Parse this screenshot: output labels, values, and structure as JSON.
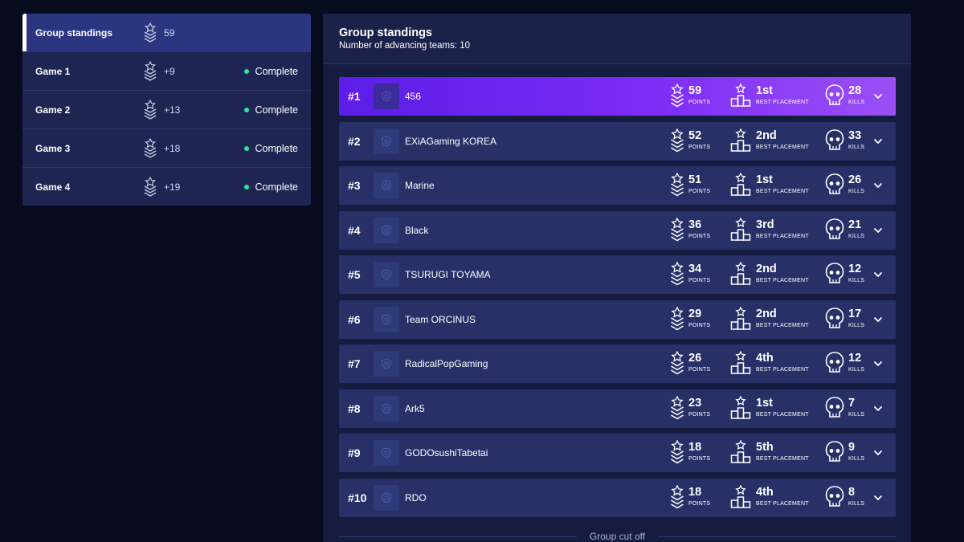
{
  "sidebar": {
    "items": [
      {
        "label": "Group standings",
        "points": "59",
        "status": ""
      },
      {
        "label": "Game 1",
        "points": "+9",
        "status": "Complete"
      },
      {
        "label": "Game 2",
        "points": "+13",
        "status": "Complete"
      },
      {
        "label": "Game 3",
        "points": "+18",
        "status": "Complete"
      },
      {
        "label": "Game 4",
        "points": "+19",
        "status": "Complete"
      }
    ]
  },
  "panel": {
    "title": "Group standings",
    "subtitle": "Number of advancing teams: 10"
  },
  "labels": {
    "points": "POINTS",
    "best_placement": "BEST PLACEMENT",
    "kills": "KILLS"
  },
  "teams": [
    {
      "rank": "#1",
      "name": "456",
      "points": "59",
      "placement": "1st",
      "kills": "28"
    },
    {
      "rank": "#2",
      "name": "EXiAGaming KOREA",
      "points": "52",
      "placement": "2nd",
      "kills": "33"
    },
    {
      "rank": "#3",
      "name": "Marine",
      "points": "51",
      "placement": "1st",
      "kills": "26"
    },
    {
      "rank": "#4",
      "name": "Black",
      "points": "36",
      "placement": "3rd",
      "kills": "21"
    },
    {
      "rank": "#5",
      "name": "TSURUGI TOYAMA",
      "points": "34",
      "placement": "2nd",
      "kills": "12"
    },
    {
      "rank": "#6",
      "name": "Team ORCINUS",
      "points": "29",
      "placement": "2nd",
      "kills": "17"
    },
    {
      "rank": "#7",
      "name": "RadicalPopGaming",
      "points": "26",
      "placement": "4th",
      "kills": "12"
    },
    {
      "rank": "#8",
      "name": "Ark5",
      "points": "23",
      "placement": "1st",
      "kills": "7"
    },
    {
      "rank": "#9",
      "name": "GODOsushiTabetai",
      "points": "18",
      "placement": "5th",
      "kills": "9"
    },
    {
      "rank": "#10",
      "name": "RDO",
      "points": "18",
      "placement": "4th",
      "kills": "8"
    }
  ],
  "cutoff_label": "Group cut off",
  "colors": {
    "background": "#070b1e",
    "panel": "#151c40",
    "row": "#273168",
    "first_row_accent": "#7b2cf5",
    "complete_dot": "#2ee59d"
  }
}
